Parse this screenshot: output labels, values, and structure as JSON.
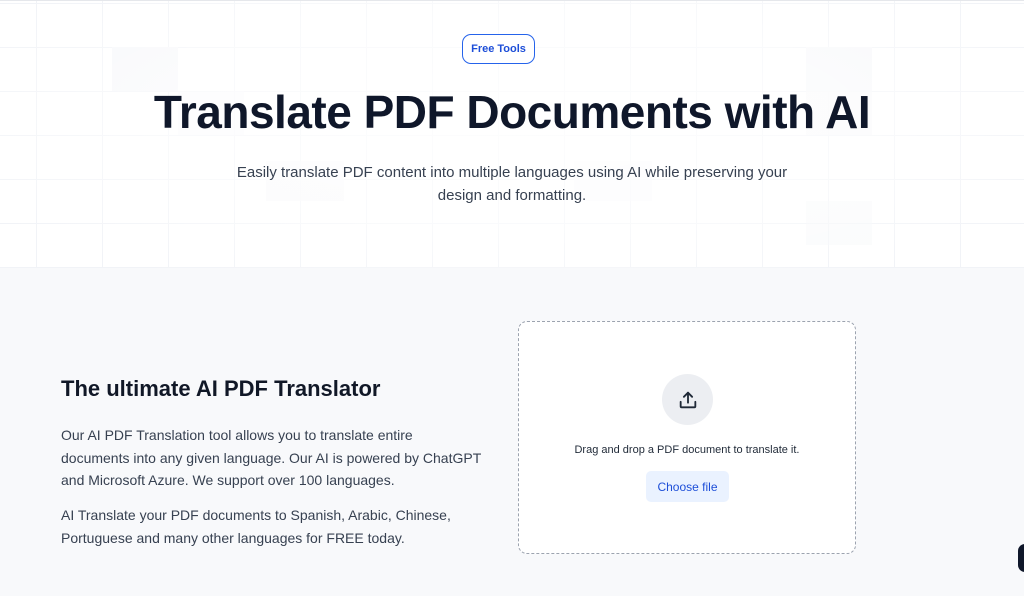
{
  "hero": {
    "badge": "Free Tools",
    "title": "Translate PDF Documents with AI",
    "subtitle_line1": "Easily translate PDF content into multiple languages using AI while preserving your",
    "subtitle_line2": "design and formatting."
  },
  "content": {
    "section_title": "The ultimate AI PDF Translator",
    "paragraph1": "Our AI PDF Translation tool allows you to translate entire documents into any given language. Our AI is powered by ChatGPT and Microsoft Azure. We support over 100 languages.",
    "paragraph2": "AI Translate your PDF documents to Spanish, Arabic, Chinese, Portuguese and many other languages for FREE today."
  },
  "upload": {
    "icon": "upload-icon",
    "instruction": "Drag and drop a PDF document to translate it.",
    "button_label": "Choose file"
  },
  "colors": {
    "accent": "#2563eb",
    "button_bg": "#eaf2ff",
    "section_bg": "#f8f9fb"
  }
}
